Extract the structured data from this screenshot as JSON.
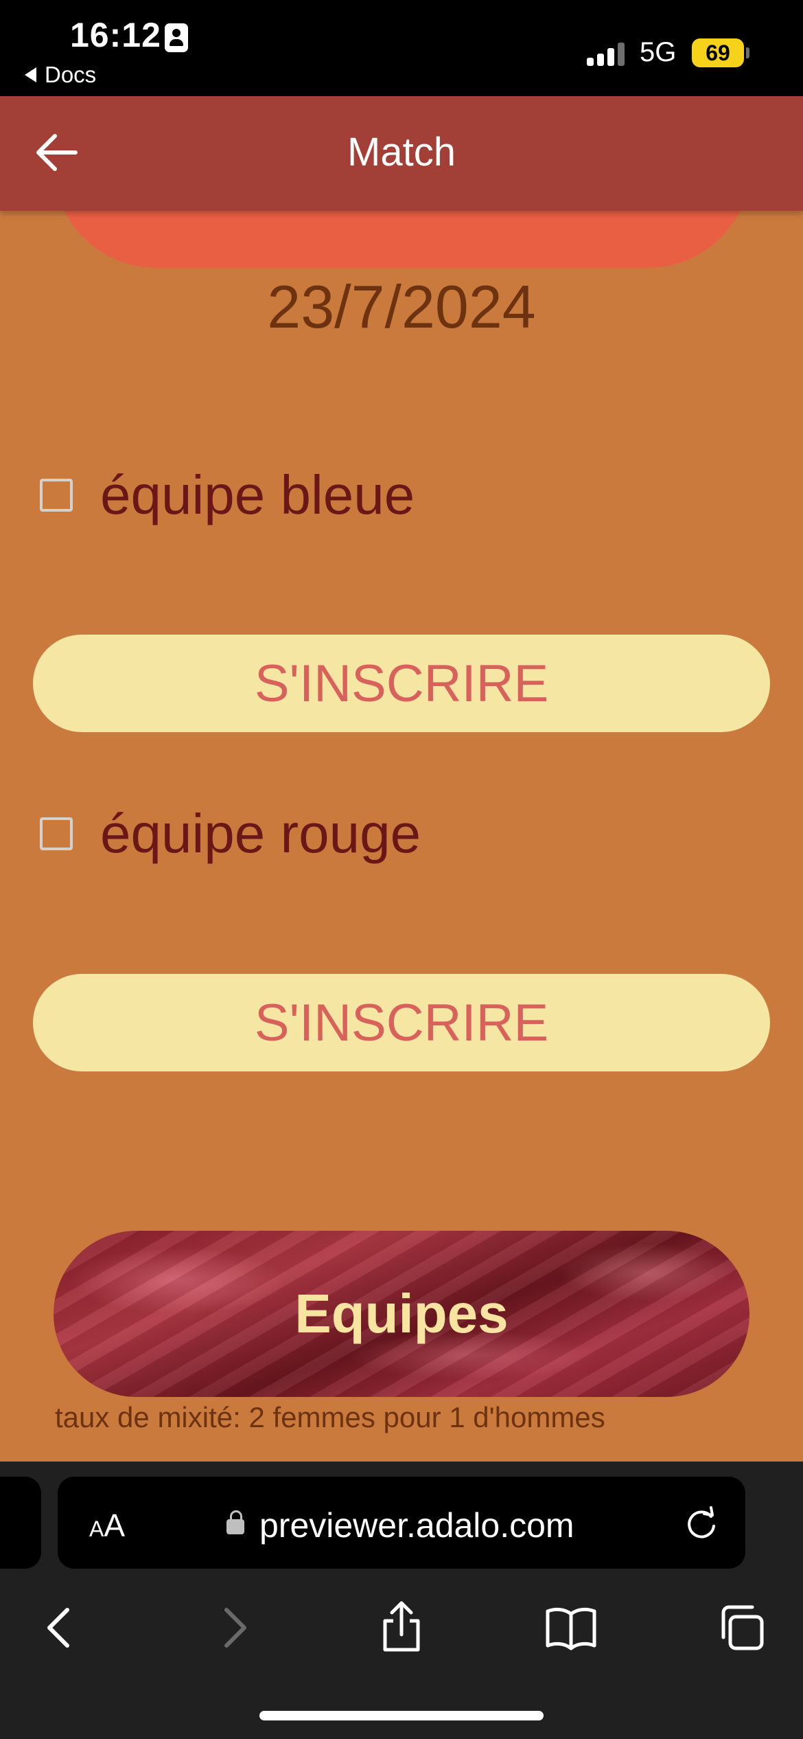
{
  "status_bar": {
    "time": "16:12",
    "back_app": "Docs",
    "network": "5G",
    "battery": "69",
    "battery_color": "#f7d21b"
  },
  "header": {
    "title": "Match"
  },
  "match": {
    "date": "23/7/2024",
    "teams": [
      {
        "label": "équipe bleue",
        "checked": false,
        "button": "S'INSCRIRE"
      },
      {
        "label": "équipe rouge",
        "checked": false,
        "button": "S'INSCRIRE"
      }
    ],
    "equipes_button": "Equipes",
    "mixite": "taux de mixité: 2 femmes pour 1 d'hommes"
  },
  "browser": {
    "aa_label_small": "A",
    "aa_label_large": "A",
    "url": "previewer.adalo.com"
  },
  "colors": {
    "background": "#cb7a3e",
    "header": "#a23f36",
    "button_fill": "#f5e6a4",
    "button_text": "#d8615b",
    "accent": "#e95f44"
  },
  "icons": {
    "header_back": "arrow-left-icon",
    "lock": "lock-icon",
    "reload": "reload-icon",
    "toolbar": [
      "chevron-left-icon",
      "chevron-right-icon",
      "share-icon",
      "book-icon",
      "tabs-icon"
    ]
  }
}
